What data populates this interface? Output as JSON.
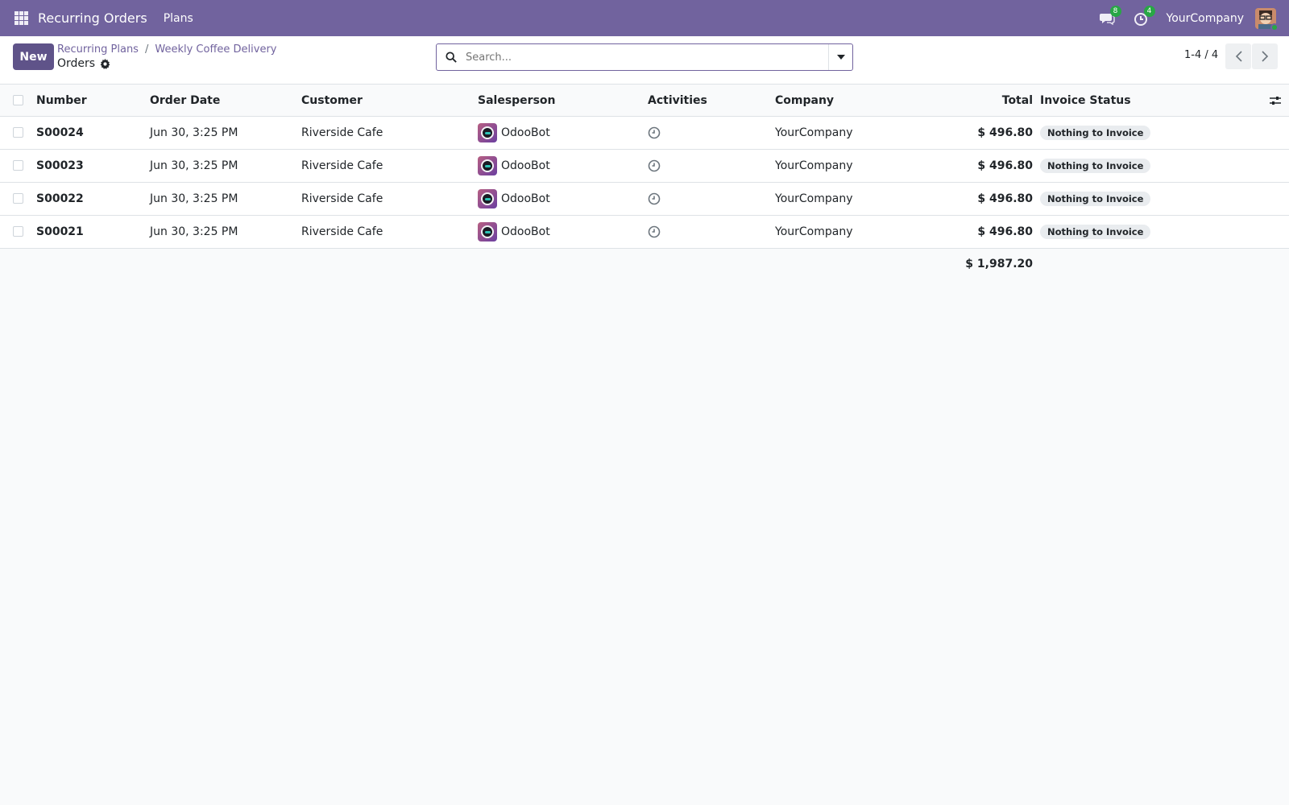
{
  "navbar": {
    "app_name": "Recurring Orders",
    "menu_plans": "Plans",
    "messages_count": "8",
    "activities_count": "4",
    "company": "YourCompany",
    "color": "#71639e"
  },
  "control_panel": {
    "new_label": "New",
    "breadcrumb": [
      "Recurring Plans",
      "Weekly Coffee Delivery"
    ],
    "breadcrumb_sep": "/",
    "current_view": "Orders",
    "search_placeholder": "Search...",
    "pager": "1-4 / 4"
  },
  "table": {
    "columns": [
      "Number",
      "Order Date",
      "Customer",
      "Salesperson",
      "Activities",
      "Company",
      "Total",
      "Invoice Status"
    ],
    "rows": [
      {
        "number": "S00024",
        "date": "Jun 30, 3:25 PM",
        "customer": "Riverside Cafe",
        "salesperson": "OdooBot",
        "company": "YourCompany",
        "total": "$ 496.80",
        "status": "Nothing to Invoice"
      },
      {
        "number": "S00023",
        "date": "Jun 30, 3:25 PM",
        "customer": "Riverside Cafe",
        "salesperson": "OdooBot",
        "company": "YourCompany",
        "total": "$ 496.80",
        "status": "Nothing to Invoice"
      },
      {
        "number": "S00022",
        "date": "Jun 30, 3:25 PM",
        "customer": "Riverside Cafe",
        "salesperson": "OdooBot",
        "company": "YourCompany",
        "total": "$ 496.80",
        "status": "Nothing to Invoice"
      },
      {
        "number": "S00021",
        "date": "Jun 30, 3:25 PM",
        "customer": "Riverside Cafe",
        "salesperson": "OdooBot",
        "company": "YourCompany",
        "total": "$ 496.80",
        "status": "Nothing to Invoice"
      }
    ],
    "grand_total": "$ 1,987.20"
  },
  "icons": {
    "apps": "apps-grid-icon",
    "messages": "chat-icon",
    "activities": "clock-icon",
    "settings": "gear-icon",
    "search": "search-icon",
    "dropdown": "caret-down-icon",
    "prev": "chevron-left-icon",
    "next": "chevron-right-icon",
    "optional_columns": "sliders-icon"
  }
}
